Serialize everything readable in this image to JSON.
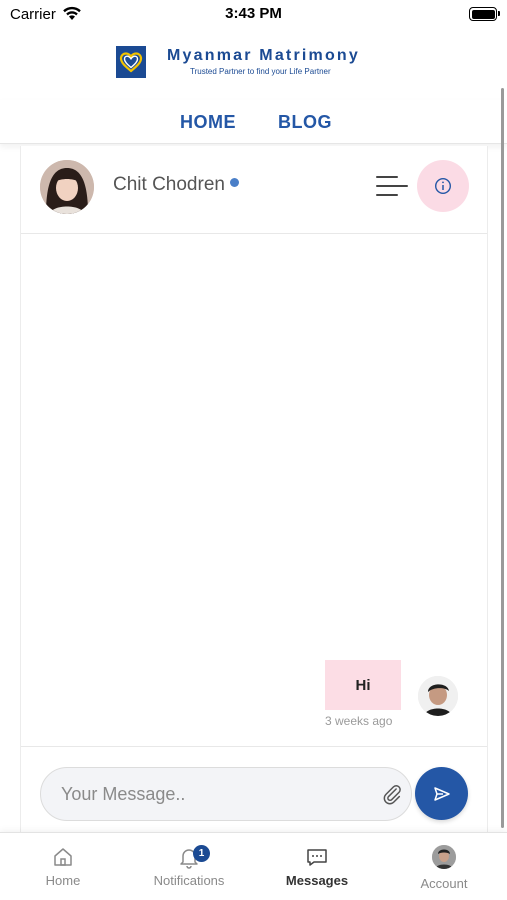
{
  "status_bar": {
    "carrier": "Carrier",
    "time": "3:43 PM"
  },
  "brand": {
    "title": "Myanmar Matrimony",
    "subtitle": "Trusted Partner to find your Life Partner",
    "logo_icon": "heart-shield-logo",
    "color": "#1b4a93"
  },
  "nav": {
    "home": "HOME",
    "blog": "BLOG"
  },
  "chat": {
    "contact_name": "Chit Chodren",
    "online_color": "#4a7fc8",
    "menu_icon": "menu-icon",
    "info_icon": "info-icon",
    "messages": [
      {
        "text": "Hi",
        "time": "3 weeks ago",
        "from": "me"
      }
    ],
    "input": {
      "placeholder": "Your Message..",
      "value": ""
    },
    "attach_icon": "paperclip-icon",
    "send_icon": "send-icon",
    "accent": "#2457a6",
    "bubble_color": "#fcdde5"
  },
  "tab_bar": {
    "tabs": [
      {
        "label": "Home",
        "icon": "home-icon"
      },
      {
        "label": "Notifications",
        "icon": "bell-icon",
        "badge": "1"
      },
      {
        "label": "Messages",
        "icon": "chat-icon",
        "active": true
      },
      {
        "label": "Account",
        "icon": "avatar"
      }
    ]
  }
}
